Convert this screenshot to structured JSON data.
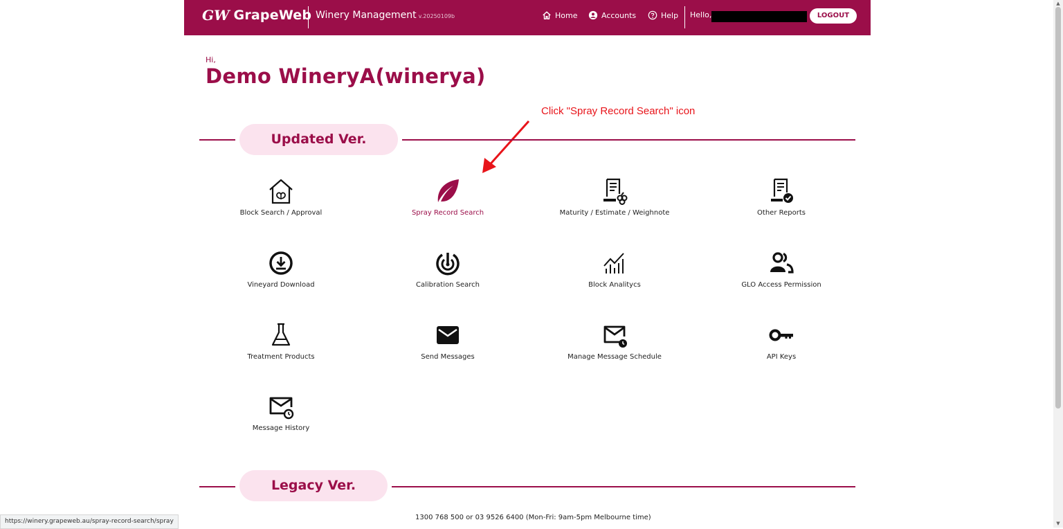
{
  "header": {
    "logo_mark": "GW",
    "logo_text": "GrapeWeb",
    "app_name": "Winery Management",
    "version": "v.20250109b",
    "nav": {
      "home": "Home",
      "accounts": "Accounts",
      "help": "Help"
    },
    "greeting": "Hello,",
    "logout": "LOGOUT"
  },
  "welcome": {
    "hi": "Hi,",
    "winery_name": "Demo WineryA(winerya)"
  },
  "annotation": "Click \"Spray Record Search\" icon",
  "sections": {
    "updated": "Updated Ver.",
    "legacy": "Legacy Ver."
  },
  "tiles": [
    {
      "label": "Block Search / Approval",
      "icon": "greenhouse-icon"
    },
    {
      "label": "Spray Record Search",
      "icon": "leaf-icon"
    },
    {
      "label": "Maturity / Estimate / Weighnote",
      "icon": "report-grapes-icon"
    },
    {
      "label": "Other Reports",
      "icon": "report-check-icon"
    },
    {
      "label": "Vineyard Download",
      "icon": "download-icon"
    },
    {
      "label": "Calibration Search",
      "icon": "calibration-icon"
    },
    {
      "label": "Block Analitycs",
      "icon": "analytics-icon"
    },
    {
      "label": "GLO Access Permission",
      "icon": "users-icon"
    },
    {
      "label": "Treatment Products",
      "icon": "flask-icon"
    },
    {
      "label": "Send Messages",
      "icon": "mail-icon"
    },
    {
      "label": "Manage Message Schedule",
      "icon": "mail-clock-icon"
    },
    {
      "label": "API Keys",
      "icon": "key-icon"
    },
    {
      "label": "Message History",
      "icon": "mail-history-icon"
    }
  ],
  "footer": {
    "contact": "1300 768 500 or 03 9526 6400 (Mon-Fri: 9am-5pm Melbourne time)"
  },
  "status_url": "https://winery.grapeweb.au/spray-record-search/spray",
  "colors": {
    "brand": "#9b0e49",
    "pill_bg": "#fbe3ee",
    "annotation": "#e8141a"
  }
}
